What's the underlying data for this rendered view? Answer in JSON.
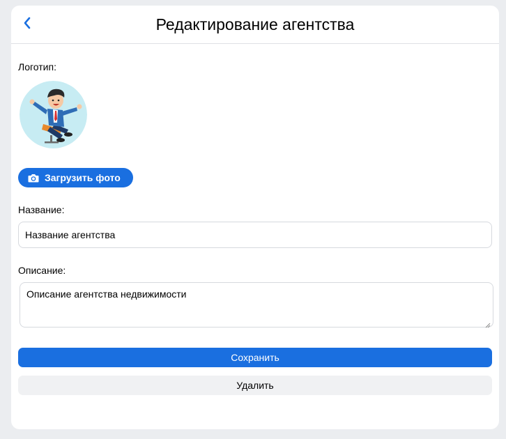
{
  "header": {
    "title": "Редактирование агентства",
    "back_icon": "chevron-left-icon"
  },
  "form": {
    "logo_label": "Логотип:",
    "upload_button_label": "Загрузить фото",
    "upload_icon": "camera-icon",
    "name_label": "Название:",
    "name_value": "Название агентства",
    "description_label": "Описание:",
    "description_value": "Описание агентства недвижимости"
  },
  "actions": {
    "save_label": "Сохранить",
    "delete_label": "Удалить"
  },
  "colors": {
    "accent": "#1a6fe0",
    "page_background": "#ebedf0",
    "secondary_button": "#f0f1f3"
  }
}
